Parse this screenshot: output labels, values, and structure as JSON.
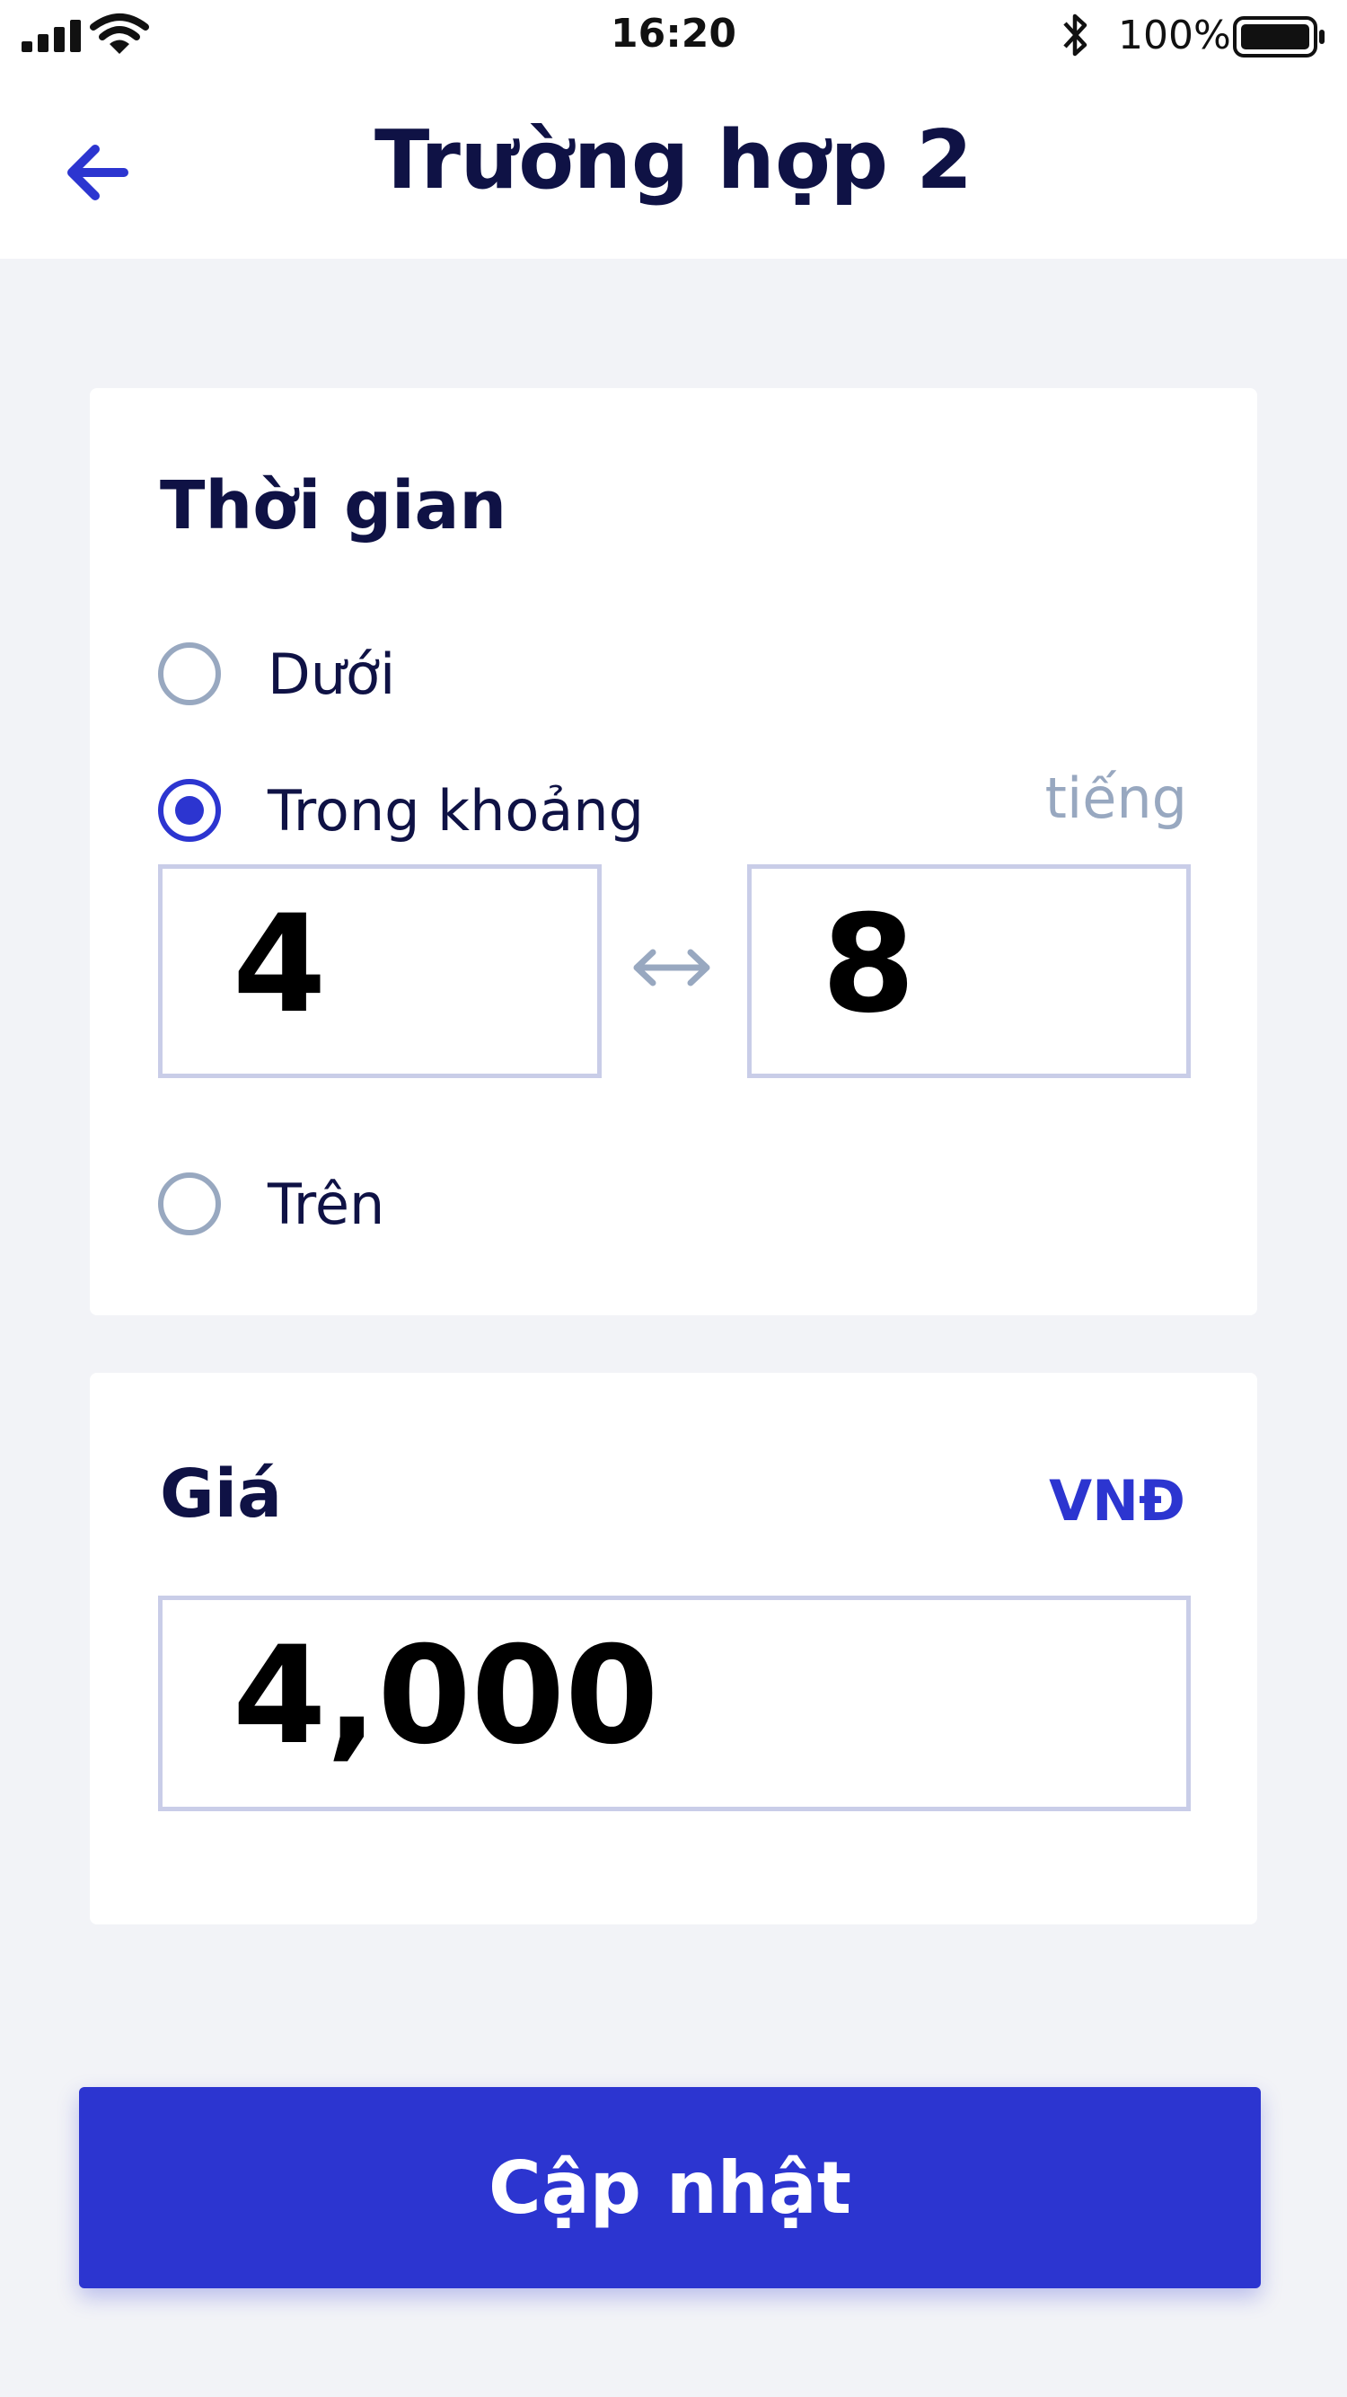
{
  "status_bar": {
    "time": "16:20",
    "battery_percent": "100%",
    "icons": [
      "signal-icon",
      "wifi-icon",
      "bluetooth-icon",
      "battery-icon"
    ]
  },
  "header": {
    "title": "Trường hợp 2",
    "back_icon": "arrow-left-icon"
  },
  "time_section": {
    "title": "Thời gian",
    "unit": "tiếng",
    "options": [
      {
        "label": "Dưới",
        "selected": false
      },
      {
        "label": "Trong khoảng",
        "selected": true
      },
      {
        "label": "Trên",
        "selected": false
      }
    ],
    "range_from": "4",
    "range_to": "8",
    "range_icon": "double-arrow-icon"
  },
  "price_section": {
    "title": "Giá",
    "currency": "VNĐ",
    "value": "4,000"
  },
  "actions": {
    "update_label": "Cập nhật"
  },
  "colors": {
    "accent": "#2c35d0",
    "text_dark": "#0f1245",
    "muted": "#98a8c0",
    "input_border": "#c9cde8",
    "background": "#f2f3f7"
  }
}
